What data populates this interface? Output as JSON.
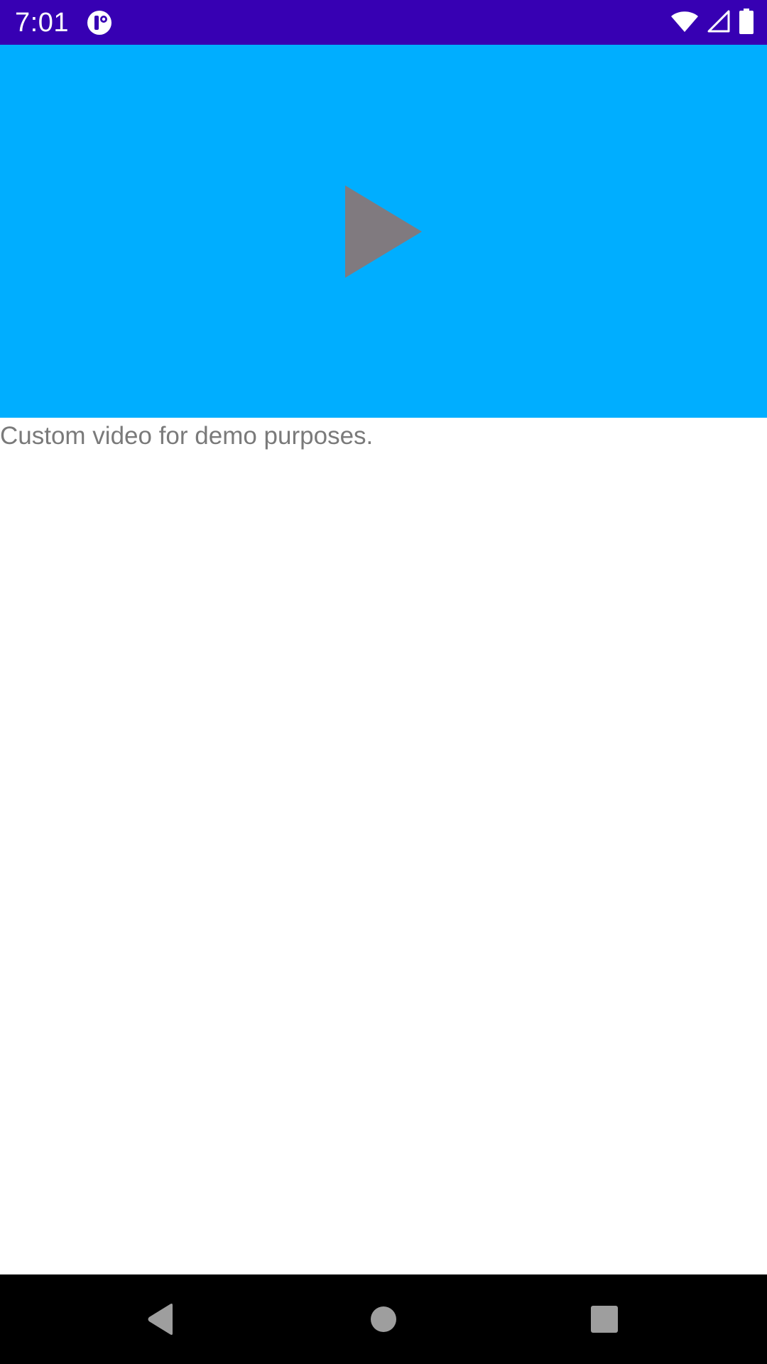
{
  "status_bar": {
    "time": "7:01",
    "background": "#3700b3",
    "app_icon": "app-notification-icon",
    "icons": [
      "wifi-icon",
      "cell-signal-icon",
      "battery-icon"
    ]
  },
  "video": {
    "background": "#00aeff",
    "play_icon": "play-icon",
    "play_color": "#807a7f"
  },
  "caption": {
    "text": "Custom video for demo purposes."
  },
  "nav_bar": {
    "icons": [
      "back-icon",
      "home-icon",
      "recents-icon"
    ]
  }
}
